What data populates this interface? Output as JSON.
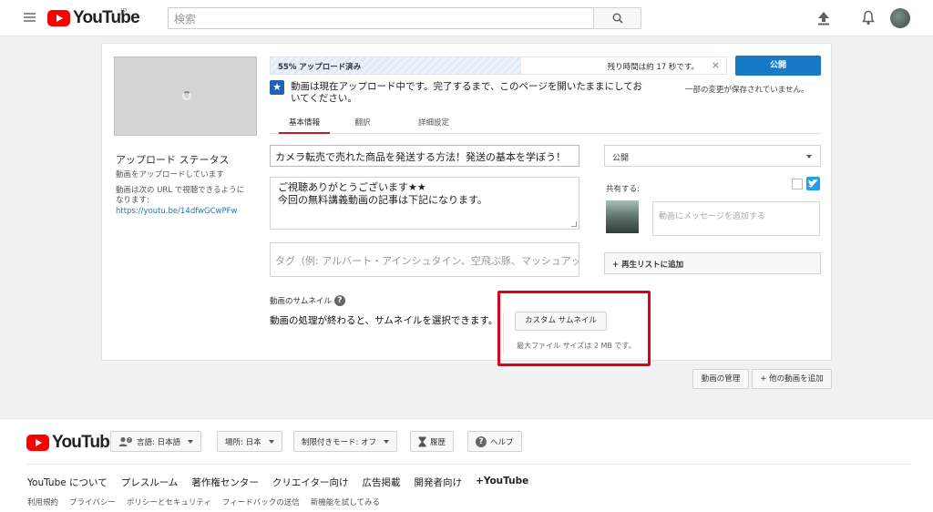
{
  "header": {
    "logo_text": "YouTube",
    "logo_region": "JP",
    "search_placeholder": "検索"
  },
  "upload": {
    "progress_label": "55% アップロード済み",
    "progress_percent": 55,
    "time_remaining": "残り時間は約 17 秒です。",
    "close_symbol": "×",
    "publish_label": "公開",
    "notice_text": "動画は現在アップロード中です。完了するまで、このページを開いたままにしておいてください。",
    "saved_note": "一部の変更が保存されていません。",
    "status_title": "アップロード ステータス",
    "status_uploading": "動画をアップロードしています",
    "status_url_line1": "動画は次の URL で視聴できるように",
    "status_url_line2": "なります:",
    "status_url": "https://youtu.be/14dfwGCwPFw"
  },
  "tabs": [
    {
      "label": "基本情報",
      "active": true
    },
    {
      "label": "翻訳",
      "active": false
    },
    {
      "label": "詳細設定",
      "active": false
    }
  ],
  "form": {
    "title_value": "カメラ転売で売れた商品を発送する方法！発送の基本を学ぼう！",
    "description_line1": "ご視聴ありがとうございます★★",
    "description_line2": "今回の無料講義動画の記事は下記になります。",
    "tags_placeholder": "タグ（例: アルバート・アインシュタイン、空飛ぶ豚、マッシュアップ）",
    "privacy_value": "公開",
    "share_label": "共有する:",
    "message_placeholder": "動画にメッセージを追加する",
    "playlist_label": "+ 再生リストに追加",
    "thumbnail_label": "動画のサムネイル",
    "help_symbol": "?",
    "thumbnail_processing": "動画の処理が終わると、サムネイルを選択できます。",
    "custom_thumbnail_label": "カスタム サムネイル",
    "max_file_size": "最大ファイル サイズは 2 MB です。"
  },
  "actions": {
    "manage_videos": "動画の管理",
    "add_more": "+ 他の動画を追加"
  },
  "footer": {
    "language": "言語: 日本語",
    "location": "場所: 日本",
    "restricted": "制限付きモード: オフ",
    "history": "履歴",
    "help": "ヘルプ",
    "links": [
      "YouTube について",
      "プレスルーム",
      "著作権センター",
      "クリエイター向け",
      "広告掲載",
      "開発者向け",
      "+YouTube"
    ],
    "sublinks": [
      "利用規約",
      "プライバシー",
      "ポリシーとセキュリティ",
      "フィードバックの送信",
      "新機能を試してみる"
    ]
  },
  "colors": {
    "brand_red": "#ff0000",
    "accent_blue": "#167ac6",
    "highlight_red": "#e0001b",
    "twitter_blue": "#1da1f2"
  }
}
